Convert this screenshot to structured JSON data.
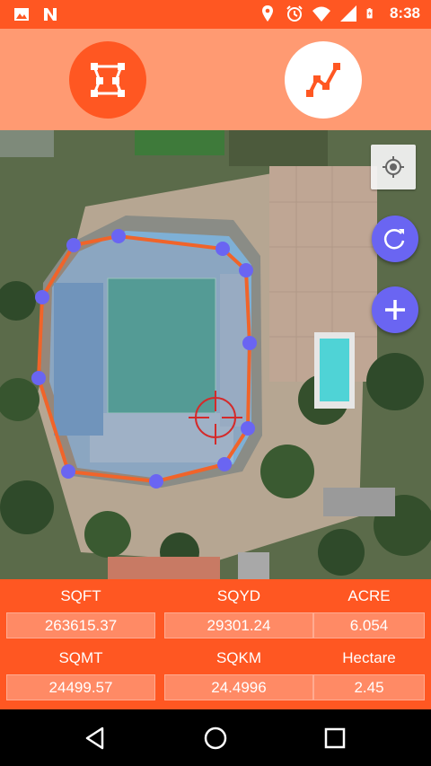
{
  "status_bar": {
    "time": "8:38",
    "left_icons": [
      "image-icon",
      "n-app-icon"
    ],
    "right_icons": [
      "location-pin-icon",
      "alarm-icon",
      "wifi-icon",
      "signal-icon",
      "battery-charging-icon"
    ]
  },
  "toolbar": {
    "modes": [
      {
        "name": "area-mode",
        "icon": "polygon-area-icon",
        "active": true
      },
      {
        "name": "distance-mode",
        "icon": "polyline-distance-icon",
        "active": false
      }
    ]
  },
  "map": {
    "controls": {
      "locate": "my-location-icon",
      "refresh": "refresh-icon",
      "add": "add-icon"
    },
    "polygon_color": "#f0642a",
    "vertex_color": "#6a65f2"
  },
  "stats": {
    "sqft": {
      "label": "SQFT",
      "value": "263615.37"
    },
    "sqyd": {
      "label": "SQYD",
      "value": "29301.24"
    },
    "acre": {
      "label": "ACRE",
      "value": "6.054"
    },
    "sqmt": {
      "label": "SQMT",
      "value": "24499.57"
    },
    "sqkm": {
      "label": "SQKM",
      "value": "24.4996"
    },
    "hectare": {
      "label": "Hectare",
      "value": "2.45"
    }
  },
  "colors": {
    "primary": "#ff5722",
    "toolbar": "#ff9a72",
    "accent": "#6a65f2"
  },
  "nav_bar": {
    "buttons": [
      "back-icon",
      "home-icon",
      "recents-icon"
    ]
  }
}
